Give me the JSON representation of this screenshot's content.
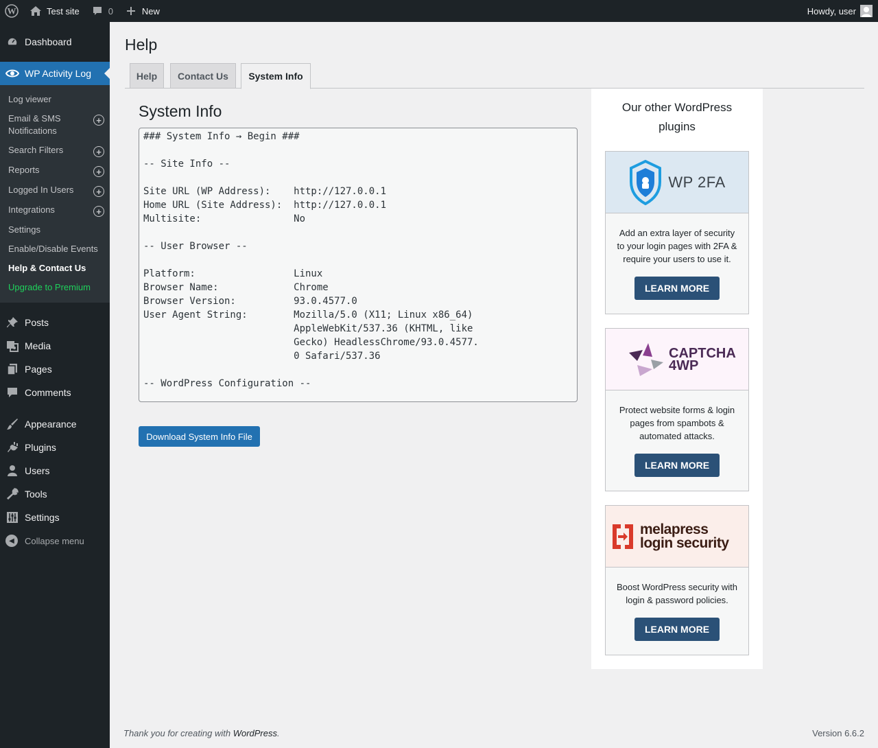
{
  "adminbar": {
    "site_name": "Test site",
    "comments_count": "0",
    "new_label": "New",
    "howdy": "Howdy, user"
  },
  "sidebar": {
    "dashboard": "Dashboard",
    "activity_log": "WP Activity Log",
    "submenu": [
      {
        "label": "Log viewer",
        "plus": false
      },
      {
        "label": "Email & SMS Notifications",
        "plus": true
      },
      {
        "label": "Search Filters",
        "plus": true
      },
      {
        "label": "Reports",
        "plus": true
      },
      {
        "label": "Logged In Users",
        "plus": true
      },
      {
        "label": "Integrations",
        "plus": true
      },
      {
        "label": "Settings",
        "plus": false
      },
      {
        "label": "Enable/Disable Events",
        "plus": false
      },
      {
        "label": "Help & Contact Us",
        "plus": false
      },
      {
        "label": "Upgrade to Premium",
        "plus": false
      }
    ],
    "posts": "Posts",
    "media": "Media",
    "pages": "Pages",
    "comments": "Comments",
    "appearance": "Appearance",
    "plugins": "Plugins",
    "users": "Users",
    "tools": "Tools",
    "settings": "Settings",
    "collapse": "Collapse menu"
  },
  "page": {
    "title": "Help",
    "tabs": [
      "Help",
      "Contact Us",
      "System Info"
    ],
    "active_tab": "System Info",
    "section_title": "System Info",
    "system_info_text": "### System Info → Begin ###\n\n-- Site Info --\n\nSite URL (WP Address):    http://127.0.0.1\nHome URL (Site Address):  http://127.0.0.1\nMultisite:                No\n\n-- User Browser --\n\nPlatform:                 Linux\nBrowser Name:             Chrome\nBrowser Version:          93.0.4577.0\nUser Agent String:        Mozilla/5.0 (X11; Linux x86_64)\n                          AppleWebKit/537.36 (KHTML, like\n                          Gecko) HeadlessChrome/93.0.4577.\n                          0 Safari/537.36\n\n-- WordPress Configuration --",
    "download_button": "Download System Info File"
  },
  "plugins_panel": {
    "title": "Our other WordPress plugins",
    "cards": [
      {
        "logo_text": "WP 2FA",
        "description": "Add an extra layer of security to your login pages with 2FA & require your users to use it.",
        "button": "LEARN MORE",
        "banner_color": "#dce8f2"
      },
      {
        "logo_text": "CAPTCHA 4WP",
        "description": "Protect website forms & login pages from spambots & automated attacks.",
        "button": "LEARN MORE",
        "banner_color": "#fdf4fb"
      },
      {
        "logo_text": "melapress login security",
        "description": "Boost WordPress security with login & password policies.",
        "button": "LEARN MORE",
        "banner_color": "#fbeeea"
      }
    ]
  },
  "footer": {
    "thanks_prefix": "Thank you for creating with ",
    "wordpress_link": "WordPress",
    "thanks_suffix": ".",
    "version": "Version 6.6.2"
  },
  "colors": {
    "admin_dark": "#1d2327",
    "accent_blue": "#2271b1",
    "upgrade_green": "#1fd15b",
    "learn_more_blue": "#2b5177"
  }
}
